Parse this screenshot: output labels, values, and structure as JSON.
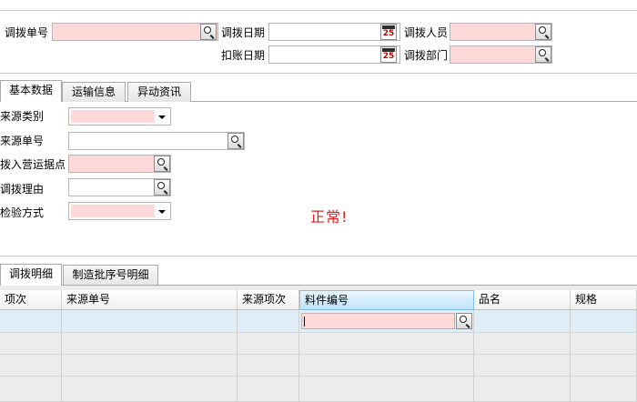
{
  "header": {
    "transfer_no_label": "调拨单号",
    "transfer_date_label": "调拨日期",
    "transfer_person_label": "调拨人员",
    "posting_date_label": "扣账日期",
    "transfer_dept_label": "调拨部门",
    "calendar_day": "25"
  },
  "tabs_top": [
    {
      "label": "基本数据"
    },
    {
      "label": "运输信息"
    },
    {
      "label": "异动资讯"
    }
  ],
  "basic": {
    "source_type_label": "来源类别",
    "source_no_label": "来源单号",
    "transfer_in_site_label": "拨入营运据点",
    "reason_label": "调拨理由",
    "inspection_label": "检验方式"
  },
  "status_text": "正常!",
  "tabs_bottom": [
    {
      "label": "调拨明细"
    },
    {
      "label": "制造批序号明细"
    }
  ],
  "grid": {
    "columns": [
      {
        "label": "项次"
      },
      {
        "label": "来源单号"
      },
      {
        "label": "来源项次"
      },
      {
        "label": "料件编号"
      },
      {
        "label": "品名"
      },
      {
        "label": "规格"
      }
    ]
  }
}
